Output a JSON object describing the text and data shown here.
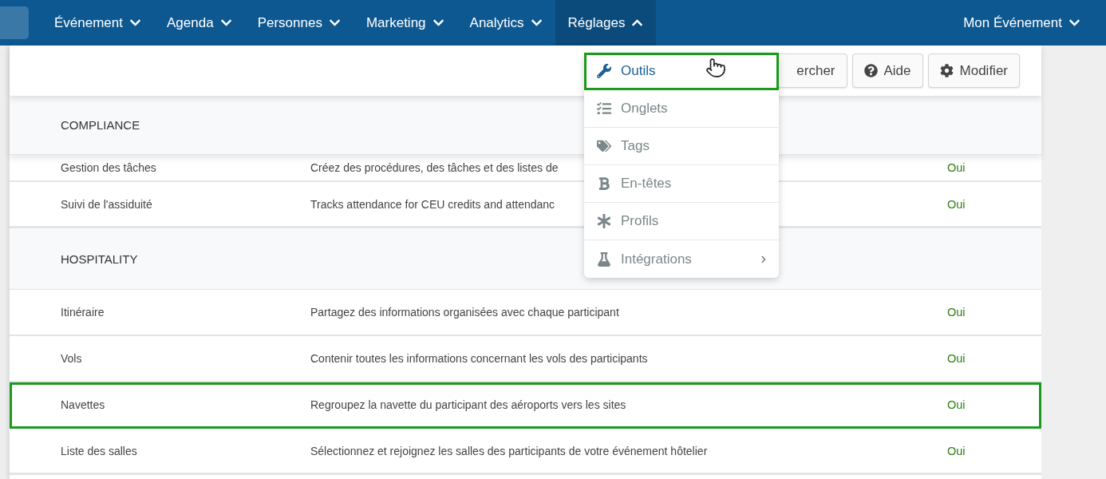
{
  "nav": {
    "items": [
      {
        "label": "Événement",
        "expanded": false,
        "selected": false
      },
      {
        "label": "Agenda",
        "expanded": false,
        "selected": false
      },
      {
        "label": "Personnes",
        "expanded": false,
        "selected": false
      },
      {
        "label": "Marketing",
        "expanded": false,
        "selected": false
      },
      {
        "label": "Analytics",
        "expanded": false,
        "selected": false
      },
      {
        "label": "Réglages",
        "expanded": true,
        "selected": true
      }
    ],
    "account": {
      "label": "Mon Événement",
      "expanded": false
    }
  },
  "toolbar": {
    "buttons": [
      {
        "label": "ercher",
        "kind": "search"
      },
      {
        "label": "Aide",
        "kind": "help"
      },
      {
        "label": "Modifier",
        "kind": "edit"
      }
    ]
  },
  "sections": [
    {
      "title": "COMPLIANCE",
      "rows": [
        {
          "name": "Gestion des tâches",
          "description": "Créez des procédures, des tâches et des listes de",
          "status": "Oui",
          "highlighted": false
        },
        {
          "name": "Suivi de l'assiduité",
          "description": "Tracks attendance for CEU credits and attendanc",
          "status": "Oui",
          "highlighted": false
        }
      ]
    },
    {
      "title": "HOSPITALITY",
      "rows": [
        {
          "name": "Itinéraire",
          "description": "Partagez des informations organisées avec chaque participant",
          "status": "Oui",
          "highlighted": false
        },
        {
          "name": "Vols",
          "description": "Contenir toutes les informations concernant les vols des participants",
          "status": "Oui",
          "highlighted": false
        },
        {
          "name": "Navettes",
          "description": "Regroupez la navette du participant des aéroports vers les sites",
          "status": "Oui",
          "highlighted": true
        },
        {
          "name": "Liste des salles",
          "description": "Sélectionnez et rejoignez les salles des participants de votre événement hôtelier",
          "status": "Oui",
          "highlighted": false
        }
      ]
    }
  ],
  "dropdown": {
    "items": [
      {
        "label": "Outils",
        "kind": "wrench",
        "highlighted": true,
        "submenu": false
      },
      {
        "label": "Onglets",
        "kind": "tasks",
        "highlighted": false,
        "submenu": false
      },
      {
        "label": "Tags",
        "kind": "tags",
        "highlighted": false,
        "submenu": false
      },
      {
        "label": "En-têtes",
        "kind": "bold",
        "highlighted": false,
        "submenu": false
      },
      {
        "label": "Profils",
        "kind": "asterisk",
        "highlighted": false,
        "submenu": false
      },
      {
        "label": "Intégrations",
        "kind": "flask",
        "highlighted": false,
        "submenu": true
      }
    ]
  }
}
